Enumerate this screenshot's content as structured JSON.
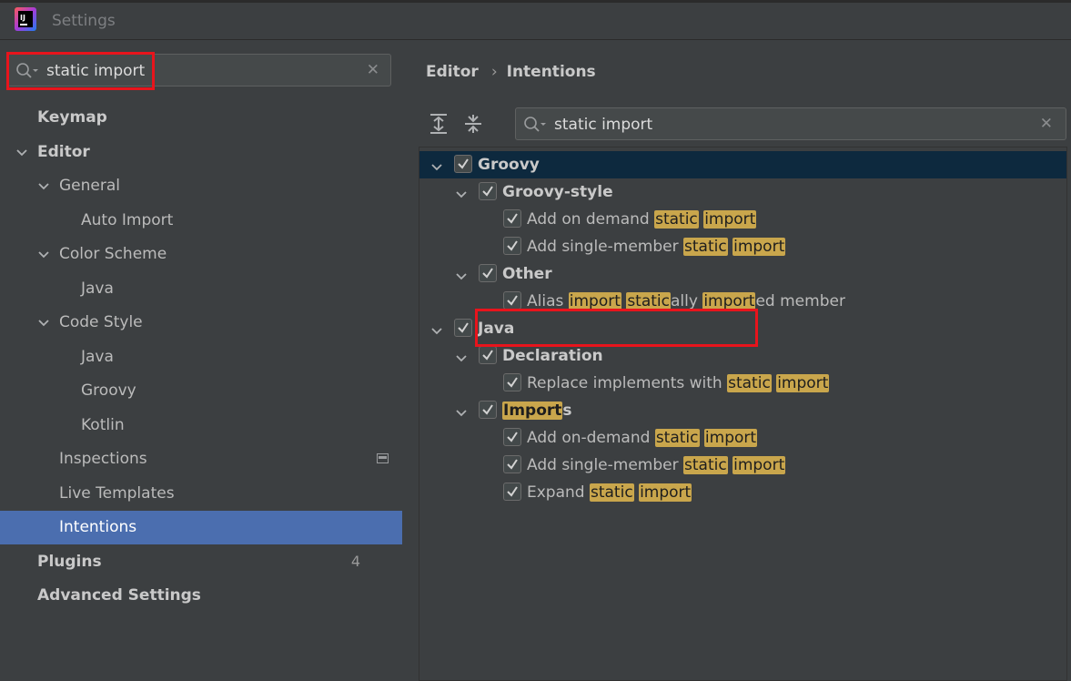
{
  "window": {
    "title": "Settings",
    "app_icon": "intellij-idea-icon"
  },
  "left": {
    "search": {
      "value": "static import",
      "icon": "search-icon",
      "clear_icon": "close-icon"
    },
    "items": [
      {
        "label": "Keymap",
        "bold": true,
        "depth": 0,
        "expanded": null
      },
      {
        "label": "Editor",
        "bold": true,
        "depth": 0,
        "expanded": true
      },
      {
        "label": "General",
        "bold": false,
        "depth": 1,
        "expanded": true
      },
      {
        "label": "Auto Import",
        "bold": false,
        "depth": 2,
        "expanded": null
      },
      {
        "label": "Color Scheme",
        "bold": false,
        "depth": 1,
        "expanded": true
      },
      {
        "label": "Java",
        "bold": false,
        "depth": 2,
        "expanded": null
      },
      {
        "label": "Code Style",
        "bold": false,
        "depth": 1,
        "expanded": true
      },
      {
        "label": "Java",
        "bold": false,
        "depth": 2,
        "expanded": null
      },
      {
        "label": "Groovy",
        "bold": false,
        "depth": 2,
        "expanded": null
      },
      {
        "label": "Kotlin",
        "bold": false,
        "depth": 2,
        "expanded": null
      },
      {
        "label": "Inspections",
        "bold": false,
        "depth": 1,
        "expanded": null,
        "icon": "project-settings-icon"
      },
      {
        "label": "Live Templates",
        "bold": false,
        "depth": 1,
        "expanded": null
      },
      {
        "label": "Intentions",
        "bold": false,
        "depth": 1,
        "expanded": null,
        "selected": true
      },
      {
        "label": "Plugins",
        "bold": true,
        "depth": 0,
        "expanded": null,
        "badge": "4"
      },
      {
        "label": "Advanced Settings",
        "bold": true,
        "depth": 0,
        "expanded": null
      }
    ]
  },
  "right": {
    "breadcrumb": {
      "parent": "Editor",
      "separator": "›",
      "current": "Intentions"
    },
    "toolbar": {
      "expand_all_icon": "expand-all-icon",
      "collapse_all_icon": "collapse-all-icon"
    },
    "search": {
      "value": "static import",
      "icon": "search-icon",
      "clear_icon": "close-icon"
    },
    "tree": [
      {
        "depth": 0,
        "expandable": true,
        "checked": true,
        "bold": true,
        "selected": true,
        "parts": [
          {
            "t": "Groovy"
          }
        ]
      },
      {
        "depth": 1,
        "expandable": true,
        "checked": true,
        "bold": true,
        "parts": [
          {
            "t": "Groovy-style"
          }
        ]
      },
      {
        "depth": 2,
        "expandable": false,
        "checked": true,
        "bold": false,
        "parts": [
          {
            "t": "Add on demand "
          },
          {
            "t": "static",
            "hl": true
          },
          {
            "t": " "
          },
          {
            "t": "import",
            "hl": true
          }
        ]
      },
      {
        "depth": 2,
        "expandable": false,
        "checked": true,
        "bold": false,
        "parts": [
          {
            "t": "Add single-member "
          },
          {
            "t": "static",
            "hl": true
          },
          {
            "t": " "
          },
          {
            "t": "import",
            "hl": true
          }
        ]
      },
      {
        "depth": 1,
        "expandable": true,
        "checked": true,
        "bold": true,
        "parts": [
          {
            "t": "Other"
          }
        ]
      },
      {
        "depth": 2,
        "expandable": false,
        "checked": true,
        "bold": false,
        "parts": [
          {
            "t": "Alias "
          },
          {
            "t": "import",
            "hl": true
          },
          {
            "t": " "
          },
          {
            "t": "static",
            "hl": true
          },
          {
            "t": "ally "
          },
          {
            "t": "import",
            "hl": true
          },
          {
            "t": "ed member"
          }
        ]
      },
      {
        "depth": 0,
        "expandable": true,
        "checked": true,
        "bold": true,
        "parts": [
          {
            "t": "Java"
          }
        ]
      },
      {
        "depth": 1,
        "expandable": true,
        "checked": true,
        "bold": true,
        "parts": [
          {
            "t": "Declaration"
          }
        ]
      },
      {
        "depth": 2,
        "expandable": false,
        "checked": true,
        "bold": false,
        "parts": [
          {
            "t": "Replace implements with "
          },
          {
            "t": "static",
            "hl": true
          },
          {
            "t": " "
          },
          {
            "t": "import",
            "hl": true
          }
        ]
      },
      {
        "depth": 1,
        "expandable": true,
        "checked": true,
        "bold": true,
        "parts": [
          {
            "t": "Import",
            "hl": true
          },
          {
            "t": "s"
          }
        ]
      },
      {
        "depth": 2,
        "expandable": false,
        "checked": true,
        "bold": false,
        "parts": [
          {
            "t": "Add on-demand "
          },
          {
            "t": "static",
            "hl": true
          },
          {
            "t": " "
          },
          {
            "t": "import",
            "hl": true
          }
        ]
      },
      {
        "depth": 2,
        "expandable": false,
        "checked": true,
        "bold": false,
        "parts": [
          {
            "t": "Add single-member "
          },
          {
            "t": "static",
            "hl": true
          },
          {
            "t": " "
          },
          {
            "t": "import",
            "hl": true
          }
        ]
      },
      {
        "depth": 2,
        "expandable": false,
        "checked": true,
        "bold": false,
        "parts": [
          {
            "t": "Expand "
          },
          {
            "t": "static",
            "hl": true
          },
          {
            "t": " "
          },
          {
            "t": "import",
            "hl": true
          }
        ]
      }
    ]
  },
  "colors": {
    "selection": "#4b6eaf",
    "tree_selection": "#0d293e",
    "search_highlight": "#c9a64c",
    "annotation_box": "#e8141c"
  }
}
